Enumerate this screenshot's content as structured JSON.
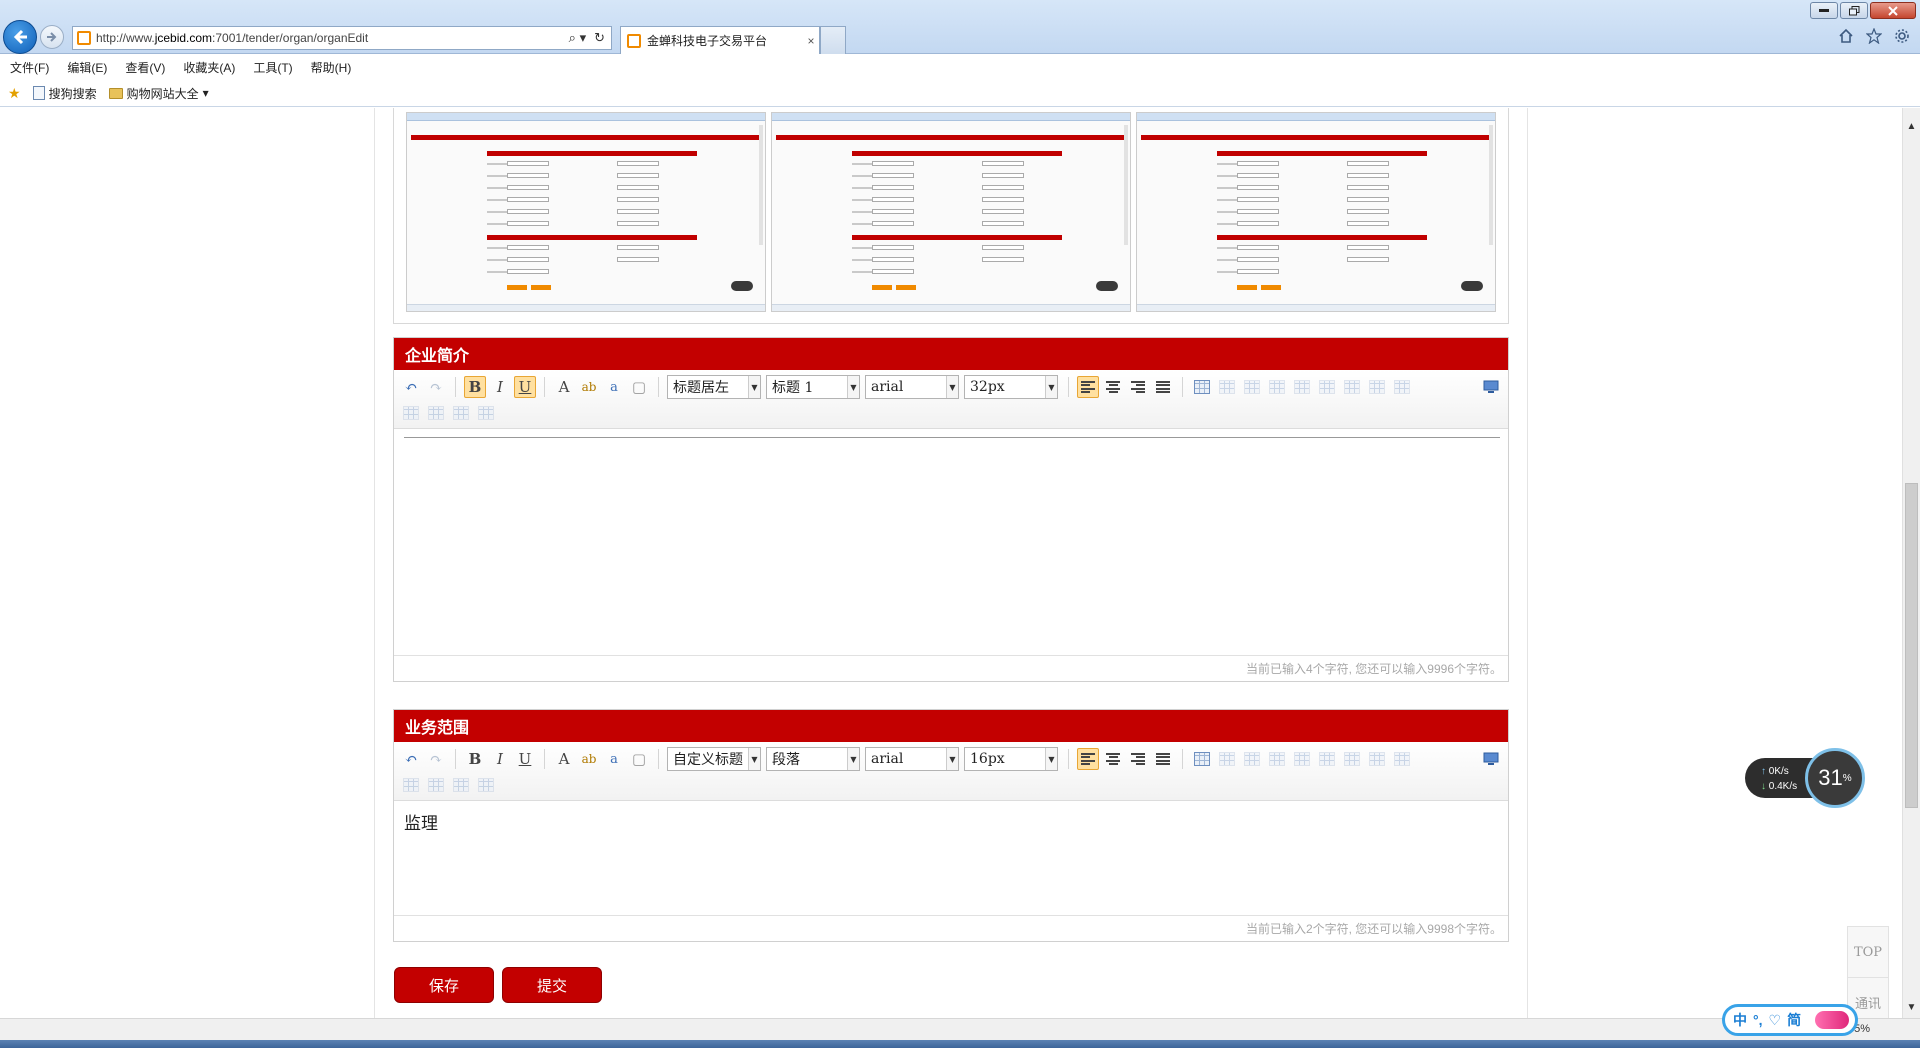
{
  "browser": {
    "url_prefix": "http://www.",
    "url_domain": "jcebid.com",
    "url_rest": ":7001/tender/organ/organEdit",
    "tab_title": "金蝉科技电子交易平台",
    "tab_close": "×",
    "search_glyph": "⌕ ▾",
    "refresh_glyph": "↻"
  },
  "menu": [
    "文件(F)",
    "编辑(E)",
    "查看(V)",
    "收藏夹(A)",
    "工具(T)",
    "帮助(H)"
  ],
  "favorites": {
    "sogou": "搜狗搜索",
    "shopping": "购物网站大全"
  },
  "sections": [
    {
      "title": "企业简介",
      "style_select": "标题居左",
      "block_select": "标题 1",
      "font_select": "arial",
      "size_select": "32px",
      "content": "",
      "word_count": "当前已输入4个字符, 您还可以输入9996个字符。"
    },
    {
      "title": "业务范围",
      "style_select": "自定义标题",
      "block_select": "段落",
      "font_select": "arial",
      "size_select": "16px",
      "content": "监理",
      "word_count": "当前已输入2个字符, 您还可以输入9998个字符。"
    }
  ],
  "toolbar_glyphs": {
    "undo": "↶",
    "redo": "↷",
    "bold": "B",
    "italic": "I",
    "underline": "U",
    "fontcolor": "A",
    "highlight": "ab",
    "link": "a",
    "page": "▢"
  },
  "actions": {
    "save": "保存",
    "submit": "提交"
  },
  "net_widget": {
    "up": "0K/s",
    "down": "0.4K/s",
    "percent": "31",
    "percent_unit": "%"
  },
  "side_tools": {
    "top": "TOP",
    "comm": "通讯"
  },
  "ime": {
    "lang": "中",
    "mode": "简"
  },
  "status": {
    "zoom": "5%"
  }
}
